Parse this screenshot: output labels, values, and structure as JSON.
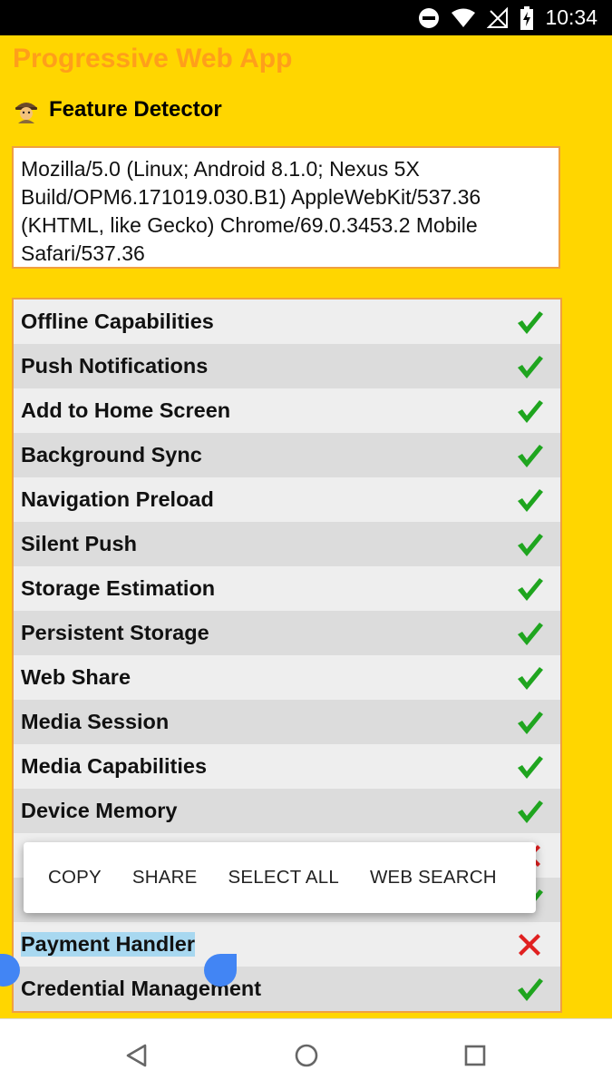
{
  "status_bar": {
    "time": "10:34",
    "icons": [
      "do-not-disturb-icon",
      "wifi-icon",
      "no-signal-icon",
      "battery-charging-icon"
    ]
  },
  "app": {
    "title": "Progressive Web App",
    "subtitle": "Feature Detector",
    "subtitle_icon": "detective-icon",
    "user_agent": "Mozilla/5.0 (Linux; Android 8.1.0; Nexus 5X Build/OPM6.171019.030.B1) AppleWebKit/537.36 (KHTML, like Gecko) Chrome/69.0.3453.2 Mobile Safari/537.36"
  },
  "features": [
    {
      "label": "Offline Capabilities",
      "supported": true
    },
    {
      "label": "Push Notifications",
      "supported": true
    },
    {
      "label": "Add to Home Screen",
      "supported": true
    },
    {
      "label": "Background Sync",
      "supported": true
    },
    {
      "label": "Navigation Preload",
      "supported": true
    },
    {
      "label": "Silent Push",
      "supported": true
    },
    {
      "label": "Storage Estimation",
      "supported": true
    },
    {
      "label": "Persistent Storage",
      "supported": true
    },
    {
      "label": "Web Share",
      "supported": true
    },
    {
      "label": "Media Session",
      "supported": true
    },
    {
      "label": "Media Capabilities",
      "supported": true
    },
    {
      "label": "Device Memory",
      "supported": true
    },
    {
      "label": "",
      "supported": false
    },
    {
      "label": "",
      "supported": true
    },
    {
      "label": "Payment Handler",
      "supported": false
    },
    {
      "label": "Credential Management",
      "supported": true
    }
  ],
  "context_menu": {
    "copy": "COPY",
    "share": "SHARE",
    "select_all": "SELECT ALL",
    "web_search": "WEB SEARCH"
  },
  "nav_bar": {
    "back": "back-icon",
    "home": "home-icon",
    "recents": "recents-icon"
  },
  "colors": {
    "background": "#ffd600",
    "title": "#ff9f1a",
    "check": "#1fa51f",
    "cross": "#e02020",
    "selection": "#a8d8f0",
    "handle": "#4285f4"
  }
}
